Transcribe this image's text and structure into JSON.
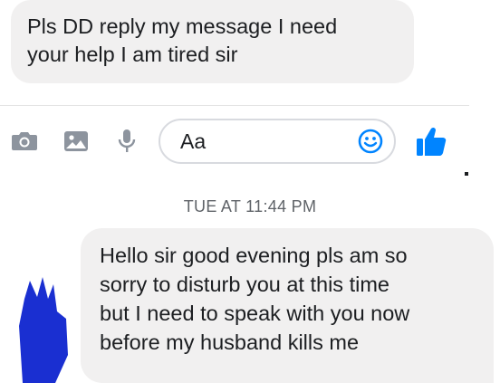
{
  "earlier_message": {
    "text": "Pls DD reply my message I need\nyour help I am tired sir"
  },
  "composer": {
    "placeholder": "Aa",
    "icons": [
      "camera-icon",
      "gallery-icon",
      "microphone-icon",
      "emoji-icon",
      "thumbs-up-icon"
    ]
  },
  "timestamp": "TUE AT 11:44 PM",
  "latest_message": {
    "text": "Hello sir good evening pls am so\nsorry to disturb you at this time\nbut I need to speak with you now\nbefore my husband kills me"
  },
  "colors": {
    "accent": "#0084ff",
    "bubble": "#f1f0f0",
    "redaction": "#1a2fd1"
  }
}
